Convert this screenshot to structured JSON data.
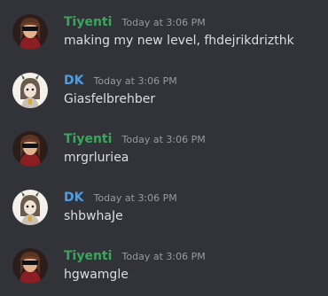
{
  "colors": {
    "background": "#313338",
    "tiyenti_name": "#3ba55d",
    "dk_name": "#4a9fe8",
    "timestamp": "#949ba4",
    "text": "#dbdee1"
  },
  "messages": [
    {
      "author": "Tiyenti",
      "avatar": "tiyenti-avatar",
      "timestamp": "Today at 3:06 PM",
      "text": "making my new level, fhdejrikdrizthk"
    },
    {
      "author": "DK",
      "avatar": "dk-avatar",
      "timestamp": "Today at 3:06 PM",
      "text": "Giasfelbrehber"
    },
    {
      "author": "Tiyenti",
      "avatar": "tiyenti-avatar",
      "timestamp": "Today at 3:06 PM",
      "text": "mrgrluriea"
    },
    {
      "author": "DK",
      "avatar": "dk-avatar",
      "timestamp": "Today at 3:06 PM",
      "text": "shbwhaJe"
    },
    {
      "author": "Tiyenti",
      "avatar": "tiyenti-avatar",
      "timestamp": "Today at 3:06 PM",
      "text": "hgwamgle"
    }
  ]
}
